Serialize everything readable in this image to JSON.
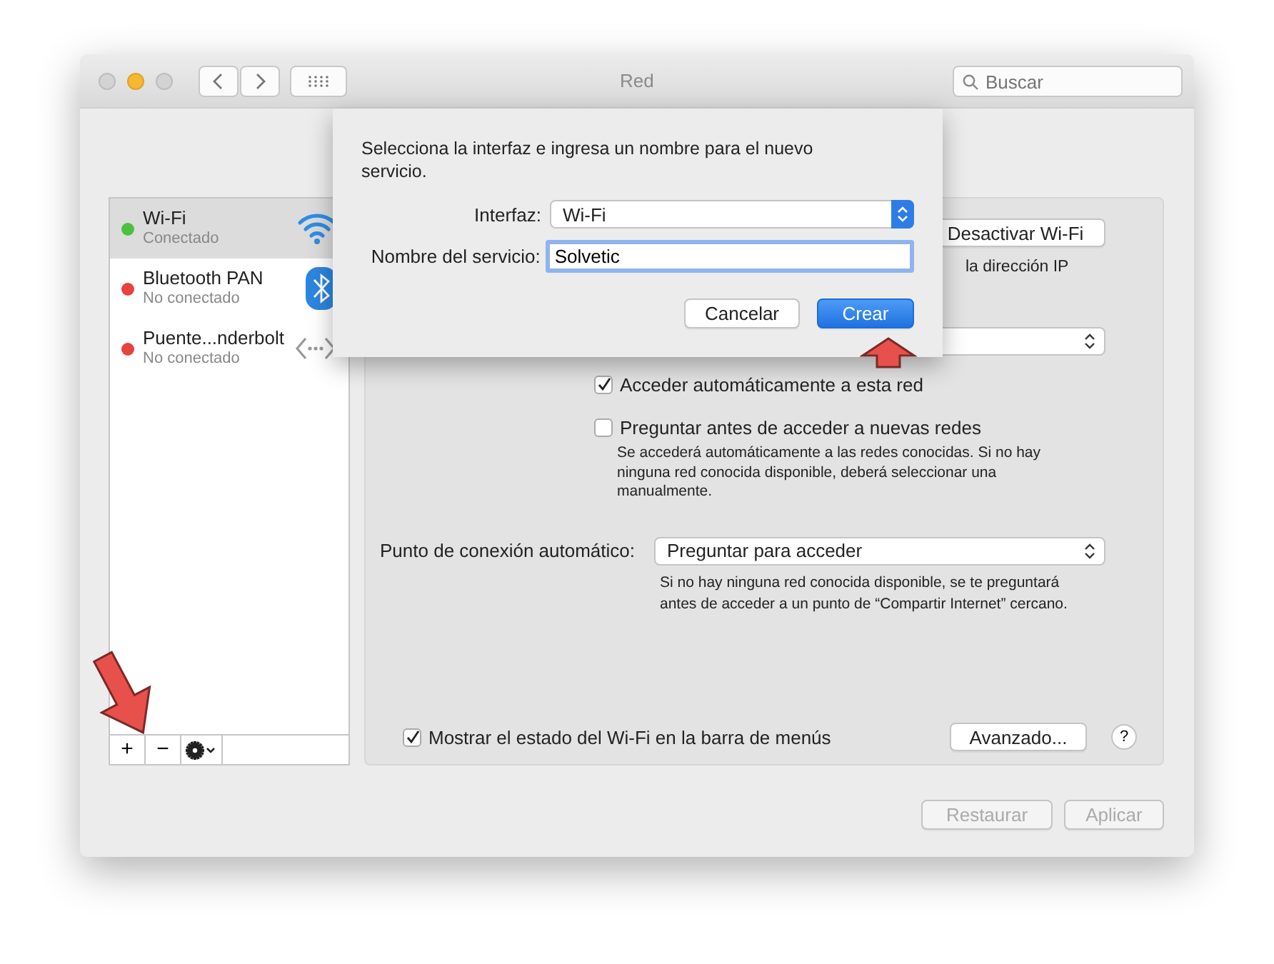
{
  "window": {
    "title": "Red",
    "traffic_lights": [
      {
        "color": "#d3d3d3"
      },
      {
        "color": "#f5b82e"
      },
      {
        "color": "#d3d3d3"
      }
    ]
  },
  "search": {
    "placeholder": "Buscar"
  },
  "sidebar": {
    "services": [
      {
        "name": "Wi-Fi",
        "status": "Conectado",
        "color": "#4cc13f",
        "kind": "wifi",
        "selected": true
      },
      {
        "name": "Bluetooth PAN",
        "status": "No conectado",
        "color": "#e8413e",
        "kind": "bluetooth",
        "selected": false
      },
      {
        "name": "Puente...nderbolt",
        "status": "No conectado",
        "color": "#e8413e",
        "kind": "bridge",
        "selected": false
      }
    ],
    "toolbar": [
      "+",
      "−"
    ]
  },
  "panel": {
    "power_button": "Desactivar Wi-Fi",
    "ip_note": "la dirección IP",
    "checkboxes": [
      {
        "label": "Acceder automáticamente a esta red",
        "checked": true
      },
      {
        "label": "Preguntar antes de acceder a nuevas redes",
        "checked": false
      }
    ],
    "ask_note": "Se accederá automáticamente a las redes conocidas. Si no hay ninguna red conocida disponible, deberá seleccionar una manualmente.",
    "hotspot_label": "Punto de conexión automático:",
    "hotspot_value": "Preguntar para acceder",
    "hotspot_note": "Si no hay ninguna red conocida disponible, se te preguntará antes de acceder a un punto de “Compartir Internet” cercano.",
    "show_status": {
      "label": "Mostrar el estado del Wi-Fi en la barra de menús",
      "checked": true
    },
    "advanced_button": "Avanzado...",
    "help_button": "?"
  },
  "footer": {
    "buttons": [
      {
        "label": "Restaurar",
        "disabled": true
      },
      {
        "label": "Aplicar",
        "disabled": true
      }
    ]
  },
  "sheet": {
    "message": "Selecciona la interfaz e ingresa un nombre para el nuevo servicio.",
    "interface_label": "Interfaz:",
    "interface_value": "Wi-Fi",
    "name_label": "Nombre del servicio:",
    "name_value": "Solvetic",
    "buttons": [
      {
        "label": "Cancelar",
        "default": false
      },
      {
        "label": "Crear",
        "default": true
      }
    ]
  }
}
